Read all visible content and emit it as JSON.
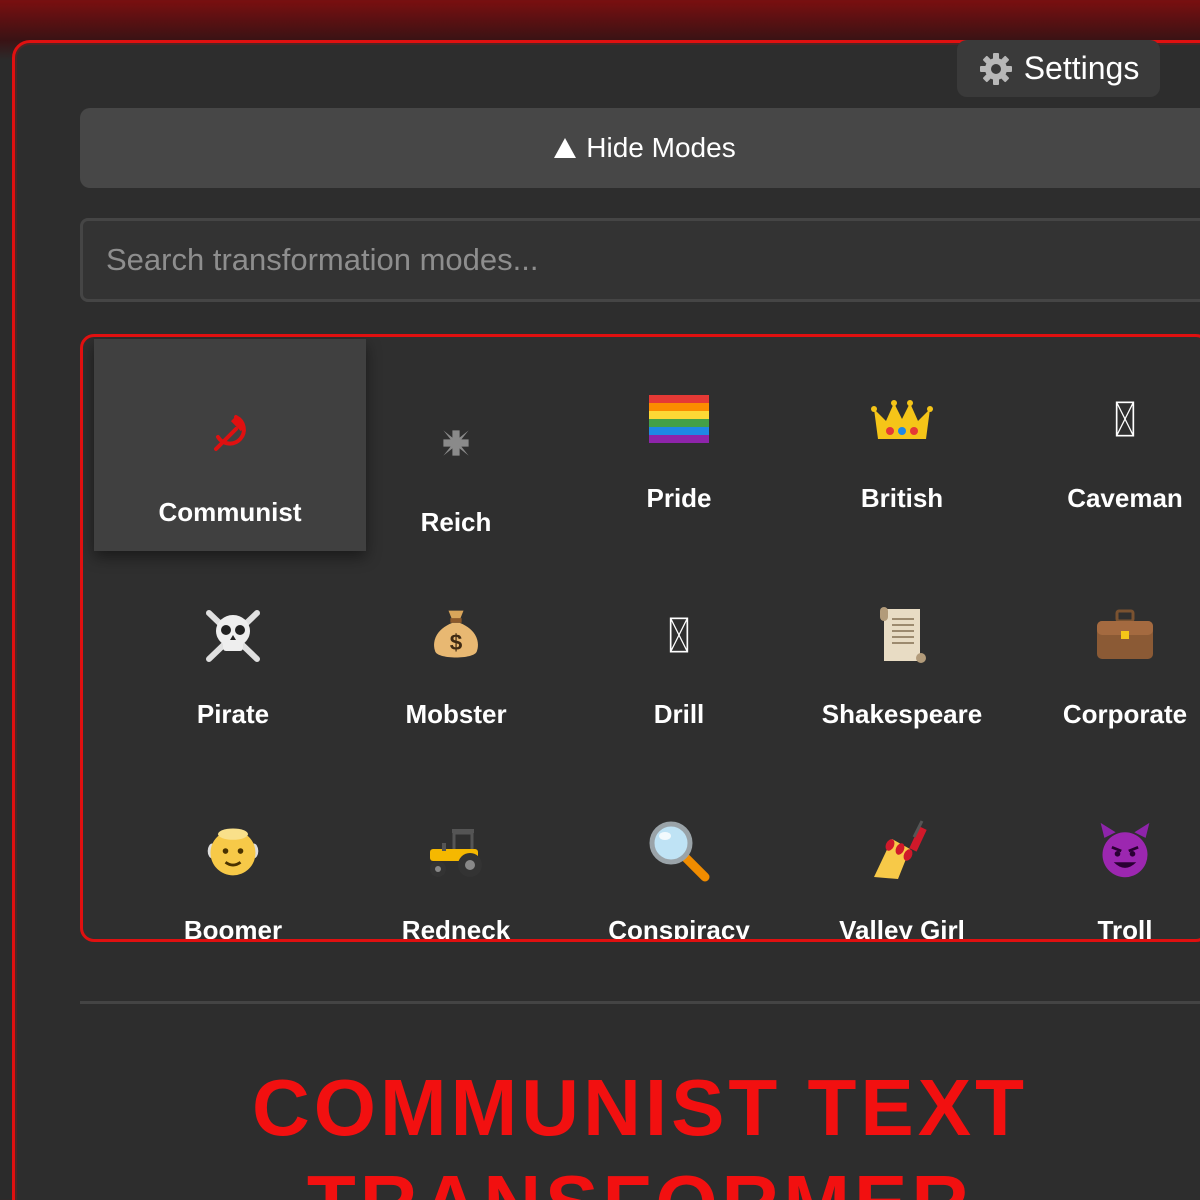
{
  "settings": {
    "label": "Settings",
    "icon": "gear-icon"
  },
  "toggle": {
    "label": "Hide Modes",
    "icon": "triangle-up-icon"
  },
  "search": {
    "placeholder": "Search transformation modes..."
  },
  "modes": [
    {
      "label": "Communist",
      "icon": "hammer-sickle-icon",
      "active": true
    },
    {
      "label": "Reich",
      "icon": "iron-cross-icon"
    },
    {
      "label": "Pride",
      "icon": "rainbow-flag-icon"
    },
    {
      "label": "British",
      "icon": "crown-icon"
    },
    {
      "label": "Caveman",
      "icon": "missing-glyph-icon"
    },
    {
      "label": "Pirate",
      "icon": "skull-crossbones-icon"
    },
    {
      "label": "Mobster",
      "icon": "money-bag-icon"
    },
    {
      "label": "Drill",
      "icon": "missing-glyph-icon"
    },
    {
      "label": "Shakespeare",
      "icon": "scroll-icon"
    },
    {
      "label": "Corporate",
      "icon": "briefcase-icon"
    },
    {
      "label": "Boomer",
      "icon": "old-man-icon"
    },
    {
      "label": "Redneck",
      "icon": "tractor-icon"
    },
    {
      "label": "Conspiracy",
      "icon": "magnifying-glass-icon"
    },
    {
      "label": "Valley Girl",
      "icon": "nail-polish-icon"
    },
    {
      "label": "Troll",
      "icon": "devil-face-icon"
    }
  ],
  "title": {
    "text": "COMMUNIST TEXT TRANSFORMER"
  },
  "colors": {
    "accent": "#e01010",
    "title": "#f21010",
    "background": "#2d2d2d"
  }
}
